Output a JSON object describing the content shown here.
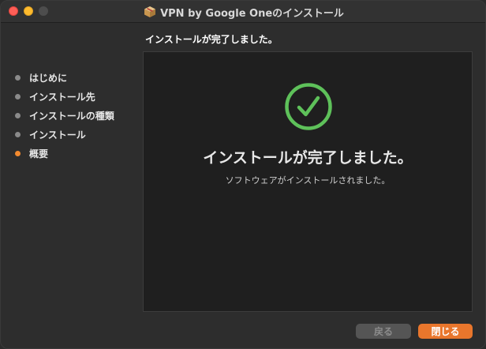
{
  "window": {
    "title": "VPN by Google Oneのインストール",
    "icon": "package-icon"
  },
  "heading": "インストールが完了しました。",
  "sidebar": {
    "steps": [
      {
        "label": "はじめに",
        "active": false
      },
      {
        "label": "インストール先",
        "active": false
      },
      {
        "label": "インストールの種類",
        "active": false
      },
      {
        "label": "インストール",
        "active": false
      },
      {
        "label": "概要",
        "active": true
      }
    ]
  },
  "main": {
    "icon": "checkmark-circle-icon",
    "message": "インストールが完了しました。",
    "submessage": "ソフトウェアがインストールされました。"
  },
  "buttons": {
    "back_label": "戻る",
    "close_label": "閉じる"
  },
  "colors": {
    "accent": "#e9762c",
    "success": "#5ec15a",
    "active_step": "#f28a2f"
  }
}
